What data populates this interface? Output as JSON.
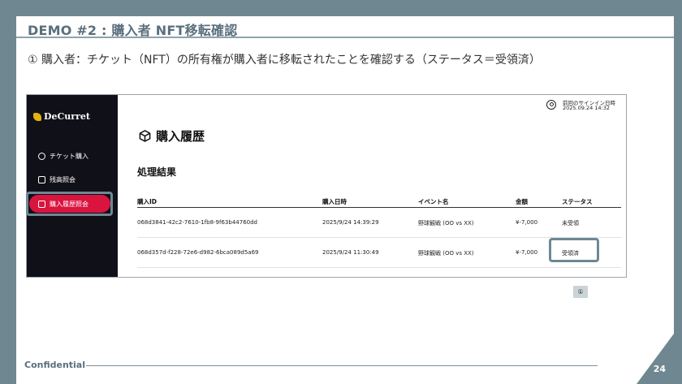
{
  "slide": {
    "title": "DEMO #2 : 購入者 NFT移転確認",
    "subtitle": "① 購入者：チケット（NFT）の所有権が購入者に移転されたことを確認する（ステータス＝受領済）",
    "footer": "Confidential",
    "page_number": "24",
    "marker": "①"
  },
  "app": {
    "logo": "DeCurret",
    "sidebar": {
      "items": [
        {
          "label": "チケット購入",
          "icon": "cube-icon"
        },
        {
          "label": "残高照会",
          "icon": "wallet-icon"
        },
        {
          "label": "購入履歴照会",
          "icon": "wallet-icon",
          "active": true
        }
      ]
    },
    "header": {
      "last_login_label": "前回のサインイン日時",
      "last_login_value": "2025.09.24 14:32"
    },
    "page_title": "購入履歴",
    "section_title": "処理結果",
    "table": {
      "headers": [
        "購入ID",
        "購入日時",
        "イベント名",
        "金額",
        "ステータス"
      ],
      "rows": [
        [
          "068d3841-42c2-7610-1fb8-9f63b44760dd",
          "2025/9/24 14:39:29",
          "野球観戦 (OO vs XX)",
          "¥-7,000",
          "未受領"
        ],
        [
          "068d357d-f228-72e6-d982-6bca089d5a69",
          "2025/9/24 11:30:49",
          "野球観戦 (OO vs XX)",
          "¥-7,000",
          "受領済"
        ]
      ]
    }
  },
  "colors": {
    "slide_frame": "#6f8791",
    "sidebar_bg": "#101018",
    "active_item": "#d9143f",
    "highlight_border": "#6d8895"
  }
}
